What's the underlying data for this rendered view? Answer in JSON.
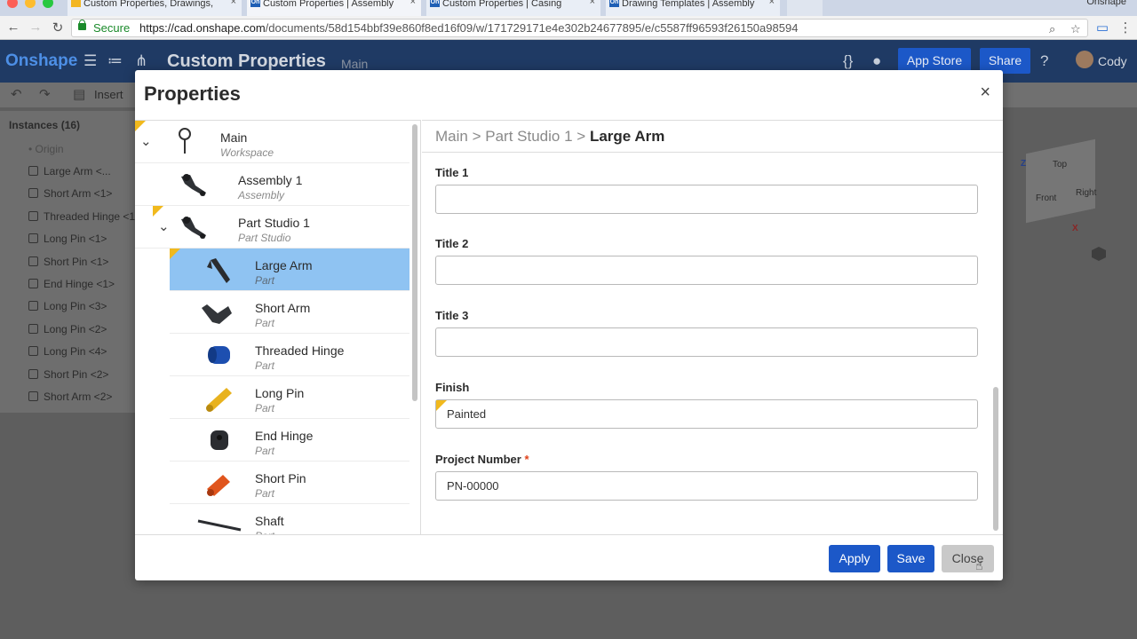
{
  "browser": {
    "tabs": [
      {
        "label": "Custom Properties, Drawings,",
        "icon": "doc-icon"
      },
      {
        "label": "Custom Properties | Assembly",
        "icon": "onshape-icon"
      },
      {
        "label": "Custom Properties | Casing",
        "icon": "onshape-icon"
      },
      {
        "label": "Drawing Templates | Assembly",
        "icon": "onshape-icon"
      }
    ],
    "fav_text": "On",
    "user": "Onshape",
    "secure_label": "Secure",
    "url_host": "https://cad.onshape.com",
    "url_path": "/documents/58d154bbf39e860f8ed16f09/w/171729171e4e302b24677895/e/c5587ff96593f26150a98594"
  },
  "app": {
    "logo": "Onshape",
    "doc_title": "Custom Properties",
    "branch": "Main",
    "app_store_label": "App Store",
    "share_label": "Share",
    "user": "Cody",
    "insert_label": "Insert",
    "instances_title": "Instances (16)",
    "instances": [
      "Origin",
      "Large Arm <...",
      "Short Arm <1>",
      "Threaded Hinge <1",
      "Long Pin <1>",
      "Short Pin <1>",
      "End Hinge <1>",
      "Long Pin <3>",
      "Long Pin <2>",
      "Long Pin <4>",
      "Short Pin <2>",
      "Short Arm <2>"
    ],
    "view_cube": {
      "top": "Top",
      "front": "Front",
      "right": "Right",
      "z": "Z",
      "x": "X"
    }
  },
  "modal": {
    "title": "Properties",
    "close_glyph": "×",
    "tree": [
      {
        "name": "Main",
        "type": "Workspace"
      },
      {
        "name": "Assembly 1",
        "type": "Assembly"
      },
      {
        "name": "Part Studio 1",
        "type": "Part Studio"
      },
      {
        "name": "Large Arm",
        "type": "Part"
      },
      {
        "name": "Short Arm",
        "type": "Part"
      },
      {
        "name": "Threaded Hinge",
        "type": "Part"
      },
      {
        "name": "Long Pin",
        "type": "Part"
      },
      {
        "name": "End Hinge",
        "type": "Part"
      },
      {
        "name": "Short Pin",
        "type": "Part"
      },
      {
        "name": "Shaft",
        "type": "Part"
      }
    ],
    "breadcrumb": {
      "part1": "Main",
      "part2": "Part Studio 1",
      "current": "Large Arm",
      "sep": ">"
    },
    "fields": [
      {
        "label": "Title 1",
        "value": ""
      },
      {
        "label": "Title 2",
        "value": ""
      },
      {
        "label": "Title 3",
        "value": ""
      },
      {
        "label": "Finish",
        "value": "Painted"
      },
      {
        "label": "Project Number",
        "value": "PN-00000",
        "required_mark": "*"
      }
    ],
    "buttons": {
      "apply": "Apply",
      "save": "Save",
      "close": "Close"
    }
  },
  "colors": {
    "accent": "#1c58c8",
    "selected": "#8fc3f2",
    "flag": "#f1b91d",
    "required": "#e0421b"
  }
}
